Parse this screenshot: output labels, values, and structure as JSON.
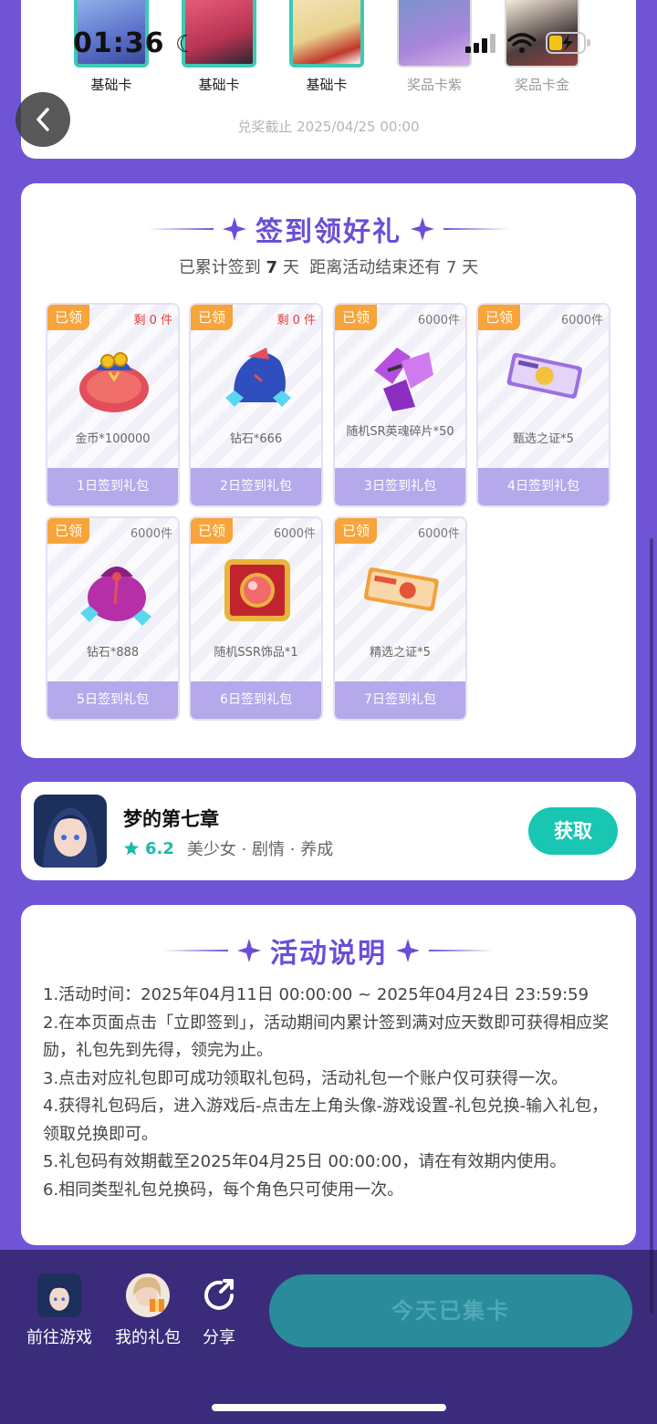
{
  "status_bar": {
    "time": "01:36"
  },
  "top_card": {
    "cards": [
      {
        "label": "基础卡",
        "kind": "basic"
      },
      {
        "label": "基础卡",
        "kind": "basic"
      },
      {
        "label": "基础卡",
        "kind": "basic"
      },
      {
        "label": "奖品卡紫",
        "kind": "prize"
      },
      {
        "label": "奖品卡金",
        "kind": "prize"
      }
    ],
    "deadline": "兑奖截止 2025/04/25 00:00"
  },
  "sign_in": {
    "title": "签到领好礼",
    "subtitle_prefix": "已累计签到",
    "signed_days": "7",
    "subtitle_mid": "天  距离活动结束还有",
    "remain_days": "7",
    "subtitle_suffix": "天",
    "gifts": [
      {
        "badge": "已领",
        "stock": "剩 0 件",
        "name": "金币*100000",
        "day": "1日签到礼包",
        "icon": "gold-coin-bag-icon"
      },
      {
        "badge": "已领",
        "stock": "剩 0 件",
        "name": "钻石*666",
        "day": "2日签到礼包",
        "icon": "diamond-bag-icon"
      },
      {
        "badge": "已领",
        "stock": "6000件",
        "name": "随机SR英魂碎片*50",
        "day": "3日签到礼包",
        "icon": "soul-fragment-icon"
      },
      {
        "badge": "已领",
        "stock": "6000件",
        "name": "甄选之证*5",
        "day": "4日签到礼包",
        "icon": "ticket-icon"
      },
      {
        "badge": "已领",
        "stock": "6000件",
        "name": "钻石*888",
        "day": "5日签到礼包",
        "icon": "diamond-pouch-icon"
      },
      {
        "badge": "已领",
        "stock": "6000件",
        "name": "随机SSR饰品*1",
        "day": "6日签到礼包",
        "icon": "treasure-box-icon"
      },
      {
        "badge": "已领",
        "stock": "6000件",
        "name": "精选之证*5",
        "day": "7日签到礼包",
        "icon": "select-ticket-icon"
      }
    ]
  },
  "game": {
    "name": "梦的第七章",
    "rating": "6.2",
    "tags": "美少女 · 剧情 · 养成",
    "get_label": "获取"
  },
  "rules": {
    "title": "活动说明",
    "lines": [
      "1.活动时间：2025年04月11日 00:00:00 ~ 2025年04月24日 23:59:59",
      "2.在本页面点击「立即签到」，活动期间内累计签到满对应天数即可获得相应奖励，礼包先到先得，领完为止。",
      "3.点击对应礼包即可成功领取礼包码，活动礼包一个账户仅可获得一次。",
      "4.获得礼包码后，进入游戏后-点击左上角头像-游戏设置-礼包兑换-输入礼包，领取兑换即可。",
      "5.礼包码有效期截至2025年04月25日 00:00:00，请在有效期内使用。",
      "6.相同类型礼包兑换码，每个角色只可使用一次。"
    ]
  },
  "bottom_bar": {
    "go_game": "前往游戏",
    "my_gifts": "我的礼包",
    "share": "分享",
    "cta": "今天已集卡"
  },
  "colors": {
    "page_bg": "#6f55d6",
    "accent_purple": "#6a4fd6",
    "teal": "#18c6b1",
    "badge_orange": "#f7a43a",
    "day_bar": "#b5a9ec"
  }
}
